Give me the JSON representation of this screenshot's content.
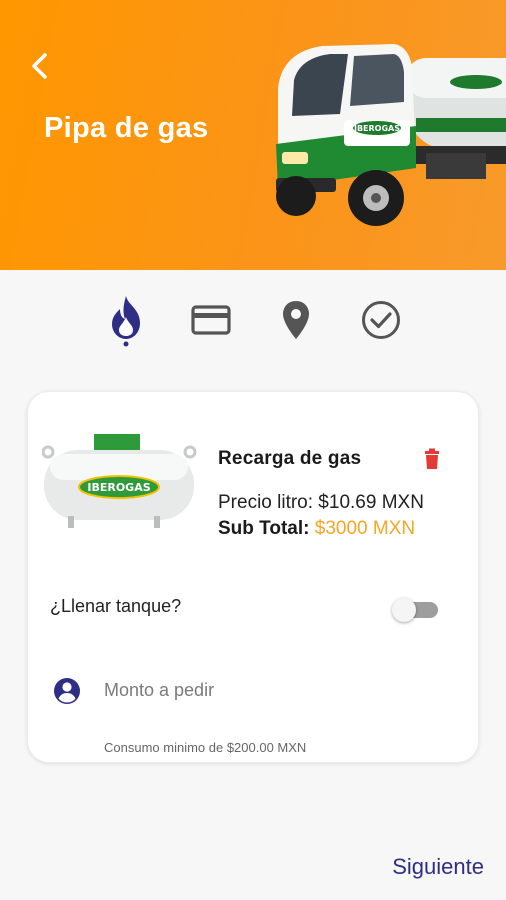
{
  "header": {
    "title": "Pipa de gas",
    "back_icon": "chevron-left-icon",
    "truck_brand": "IBEROGAS",
    "background_color": "#ff9700"
  },
  "steps": [
    {
      "icon": "flame-icon",
      "state": "active",
      "color": "#2e2e86"
    },
    {
      "icon": "credit-card-icon",
      "state": "inactive",
      "color": "#555555"
    },
    {
      "icon": "location-pin-icon",
      "state": "inactive",
      "color": "#555555"
    },
    {
      "icon": "check-circle-icon",
      "state": "inactive",
      "color": "#555555"
    }
  ],
  "product": {
    "image_brand": "IBEROGAS",
    "name": "Recarga de gas",
    "price_line": "Precio litro: $10.69 MXN",
    "subtotal_label": "Sub Total:",
    "subtotal_value": "$3000 MXN",
    "subtotal_color": "#f5a623",
    "delete_icon": "trash-icon",
    "delete_color": "#e53935"
  },
  "fill_tank": {
    "label": "¿Llenar tanque?",
    "enabled": false
  },
  "amount": {
    "icon": "account-circle-icon",
    "placeholder": "Monto a pedir",
    "value": "",
    "min_note": "Consumo minimo de $200.00 MXN"
  },
  "footer": {
    "next_label": "Siguiente",
    "accent": "#2e2e86"
  }
}
